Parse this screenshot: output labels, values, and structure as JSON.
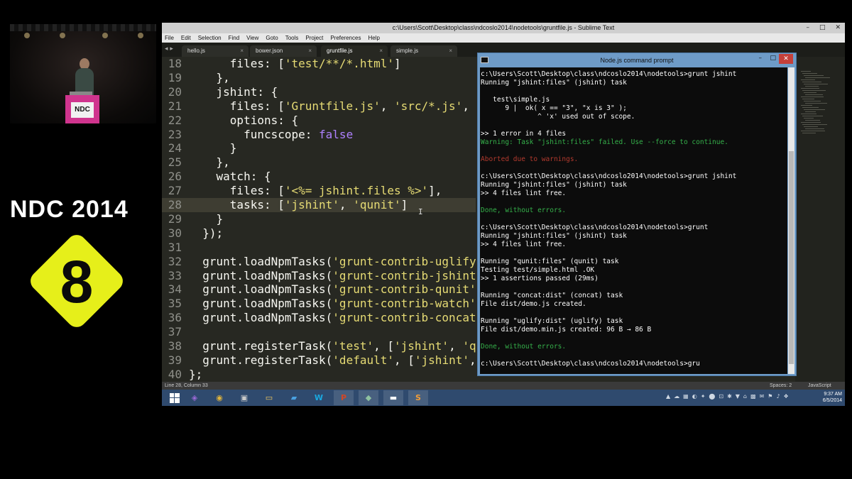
{
  "conference": {
    "title": "NDC 2014",
    "badge_number": "8",
    "podium_label": "NDC",
    "colors": {
      "accent_yellow": "#e6ef1a",
      "podium_pink": "#d0348e"
    }
  },
  "sublime": {
    "title": "c:\\Users\\Scott\\Desktop\\class\\ndcoslo2014\\nodetools\\gruntfile.js - Sublime Text",
    "window_controls": [
      "–",
      "□",
      "✕"
    ],
    "menu": [
      "File",
      "Edit",
      "Selection",
      "Find",
      "View",
      "Goto",
      "Tools",
      "Project",
      "Preferences",
      "Help"
    ],
    "tab_nav": "◂ ▸",
    "tabs": [
      {
        "label": "hello.js",
        "close": "×"
      },
      {
        "label": "bower.json",
        "close": "×"
      },
      {
        "label": "gruntfile.js",
        "close": "×"
      },
      {
        "label": "simple.js",
        "close": "×"
      }
    ],
    "active_tab": 2,
    "code_lines": [
      {
        "n": "18",
        "parts": [
          [
            "k",
            "      files: ["
          ],
          [
            "s",
            "'test/**/*.html'"
          ],
          [
            "k",
            "]"
          ]
        ]
      },
      {
        "n": "19",
        "parts": [
          [
            "k",
            "    },"
          ]
        ]
      },
      {
        "n": "20",
        "parts": [
          [
            "k",
            "    jshint: {"
          ]
        ]
      },
      {
        "n": "21",
        "parts": [
          [
            "k",
            "      files: ["
          ],
          [
            "s",
            "'Gruntfile.js'"
          ],
          [
            "k",
            ", "
          ],
          [
            "s",
            "'src/*.js'"
          ],
          [
            "k",
            ", "
          ],
          [
            "s",
            "'te"
          ]
        ]
      },
      {
        "n": "22",
        "parts": [
          [
            "k",
            "      options: {"
          ]
        ]
      },
      {
        "n": "23",
        "parts": [
          [
            "k",
            "        funcscope: "
          ],
          [
            "c",
            "false"
          ]
        ]
      },
      {
        "n": "24",
        "parts": [
          [
            "k",
            "      }"
          ]
        ]
      },
      {
        "n": "25",
        "parts": [
          [
            "k",
            "    },"
          ]
        ]
      },
      {
        "n": "26",
        "parts": [
          [
            "k",
            "    watch: {"
          ]
        ]
      },
      {
        "n": "27",
        "parts": [
          [
            "k",
            "      files: ["
          ],
          [
            "s",
            "'<%= jshint.files %>'"
          ],
          [
            "k",
            "],"
          ]
        ]
      },
      {
        "n": "28",
        "parts": [
          [
            "k",
            "      tasks: ["
          ],
          [
            "s",
            "'jshint'"
          ],
          [
            "k",
            ", "
          ],
          [
            "s",
            "'qunit'"
          ],
          [
            "k",
            "]"
          ]
        ],
        "current": true
      },
      {
        "n": "29",
        "parts": [
          [
            "k",
            "    }"
          ]
        ]
      },
      {
        "n": "30",
        "parts": [
          [
            "k",
            "  });"
          ]
        ]
      },
      {
        "n": "31",
        "parts": [
          [
            "k",
            ""
          ]
        ]
      },
      {
        "n": "32",
        "parts": [
          [
            "k",
            "  grunt.loadNpmTasks("
          ],
          [
            "s",
            "'grunt-contrib-uglify'"
          ],
          [
            "k",
            ");"
          ]
        ]
      },
      {
        "n": "33",
        "parts": [
          [
            "k",
            "  grunt.loadNpmTasks("
          ],
          [
            "s",
            "'grunt-contrib-jshint'"
          ],
          [
            "k",
            ");"
          ]
        ]
      },
      {
        "n": "34",
        "parts": [
          [
            "k",
            "  grunt.loadNpmTasks("
          ],
          [
            "s",
            "'grunt-contrib-qunit'"
          ],
          [
            "k",
            ");"
          ]
        ]
      },
      {
        "n": "35",
        "parts": [
          [
            "k",
            "  grunt.loadNpmTasks("
          ],
          [
            "s",
            "'grunt-contrib-watch'"
          ],
          [
            "k",
            ");"
          ]
        ]
      },
      {
        "n": "36",
        "parts": [
          [
            "k",
            "  grunt.loadNpmTasks("
          ],
          [
            "s",
            "'grunt-contrib-concat'"
          ],
          [
            "k",
            ");"
          ]
        ]
      },
      {
        "n": "37",
        "parts": [
          [
            "k",
            ""
          ]
        ]
      },
      {
        "n": "38",
        "parts": [
          [
            "k",
            "  grunt.registerTask("
          ],
          [
            "s",
            "'test'"
          ],
          [
            "k",
            ", ["
          ],
          [
            "s",
            "'jshint'"
          ],
          [
            "k",
            ", "
          ],
          [
            "s",
            "'quni"
          ]
        ]
      },
      {
        "n": "39",
        "parts": [
          [
            "k",
            "  grunt.registerTask("
          ],
          [
            "s",
            "'default'"
          ],
          [
            "k",
            ", ["
          ],
          [
            "s",
            "'jshint'"
          ],
          [
            "k",
            ", "
          ],
          [
            "s",
            "'c"
          ]
        ]
      },
      {
        "n": "40",
        "parts": [
          [
            "k",
            "};"
          ]
        ]
      }
    ],
    "cursor_glyph": "I",
    "status": {
      "position": "Line 28, Column 33",
      "spaces": "Spaces: 2",
      "syntax": "JavaScript"
    },
    "colors": {
      "background": "#272822",
      "string": "#e6db74",
      "constant": "#ae81ff",
      "gutter": "#8f908a"
    }
  },
  "cmd": {
    "title": "Node.js command prompt",
    "min": "–",
    "max": "□",
    "close": "✕",
    "lines": [
      {
        "t": "c:\\Users\\Scott\\Desktop\\class\\ndcoslo2014\\nodetools>grunt jshint",
        "c": "w"
      },
      {
        "t": "Running \"jshint:files\" (jshint) task",
        "c": "w"
      },
      {
        "t": "",
        "c": "w"
      },
      {
        "t": "   test\\simple.js",
        "c": "w"
      },
      {
        "t": "      9 |  ok( x == \"3\", \"x is 3\" );",
        "c": "w"
      },
      {
        "t": "              ^ 'x' used out of scope.",
        "c": "w"
      },
      {
        "t": "",
        "c": "w"
      },
      {
        "t": ">> 1 error in 4 files",
        "c": "w"
      },
      {
        "t": "Warning: Task \"jshint:files\" failed. Use --force to continue.",
        "c": "g"
      },
      {
        "t": "",
        "c": "w"
      },
      {
        "t": "Aborted due to warnings.",
        "c": "r"
      },
      {
        "t": "",
        "c": "w"
      },
      {
        "t": "c:\\Users\\Scott\\Desktop\\class\\ndcoslo2014\\nodetools>grunt jshint",
        "c": "w"
      },
      {
        "t": "Running \"jshint:files\" (jshint) task",
        "c": "w"
      },
      {
        "t": ">> 4 files lint free.",
        "c": "w"
      },
      {
        "t": "",
        "c": "w"
      },
      {
        "t": "Done, without errors.",
        "c": "g"
      },
      {
        "t": "",
        "c": "w"
      },
      {
        "t": "c:\\Users\\Scott\\Desktop\\class\\ndcoslo2014\\nodetools>grunt",
        "c": "w"
      },
      {
        "t": "Running \"jshint:files\" (jshint) task",
        "c": "w"
      },
      {
        "t": ">> 4 files lint free.",
        "c": "w"
      },
      {
        "t": "",
        "c": "w"
      },
      {
        "t": "Running \"qunit:files\" (qunit) task",
        "c": "w"
      },
      {
        "t": "Testing test/simple.html .OK",
        "c": "w"
      },
      {
        "t": ">> 1 assertions passed (29ms)",
        "c": "w"
      },
      {
        "t": "",
        "c": "w"
      },
      {
        "t": "Running \"concat:dist\" (concat) task",
        "c": "w"
      },
      {
        "t": "File dist/demo.js created.",
        "c": "w"
      },
      {
        "t": "",
        "c": "w"
      },
      {
        "t": "Running \"uglify:dist\" (uglify) task",
        "c": "w"
      },
      {
        "t": "File dist/demo.min.js created: 96 B → 86 B",
        "c": "w"
      },
      {
        "t": "",
        "c": "w"
      },
      {
        "t": "Done, without errors.",
        "c": "g"
      },
      {
        "t": "",
        "c": "w"
      },
      {
        "t": "c:\\Users\\Scott\\Desktop\\class\\ndcoslo2014\\nodetools>gru",
        "c": "w"
      }
    ],
    "colors": {
      "frame": "#6e9bc7",
      "console": "#0c0c0c",
      "success": "#35b04a",
      "error": "#b23a2e"
    }
  },
  "taskbar": {
    "start_icon": "windows-start-icon",
    "apps": [
      {
        "name": "visual-studio-icon",
        "glyph": "◈",
        "color": "#9b6ad6"
      },
      {
        "name": "chrome-icon",
        "glyph": "◉",
        "color": "#e0b43c"
      },
      {
        "name": "pro-app-icon",
        "glyph": "▣",
        "color": "#c9c9c9"
      },
      {
        "name": "file-explorer-icon",
        "glyph": "▭",
        "color": "#f0c75e"
      },
      {
        "name": "remote-desktop-icon",
        "glyph": "▰",
        "color": "#4aa0e0"
      },
      {
        "name": "webstorm-icon",
        "glyph": "W",
        "color": "#1aa9e0"
      },
      {
        "name": "powerpoint-icon",
        "glyph": "P",
        "color": "#d24726"
      },
      {
        "name": "app-diamond-icon",
        "glyph": "◆",
        "color": "#8fc2a0"
      },
      {
        "name": "command-prompt-icon",
        "glyph": "▬",
        "color": "#ffffff"
      },
      {
        "name": "sublime-text-icon",
        "glyph": "S",
        "color": "#f29d38"
      }
    ],
    "tray": [
      "▲",
      "☁",
      "▦",
      "◐",
      "✦",
      "⬤",
      "⊡",
      "✱",
      "▼",
      "⌂",
      "▩",
      "✉",
      "⚑",
      "♪",
      "❖"
    ],
    "time": "9:37 AM",
    "date": "6/5/2014"
  }
}
